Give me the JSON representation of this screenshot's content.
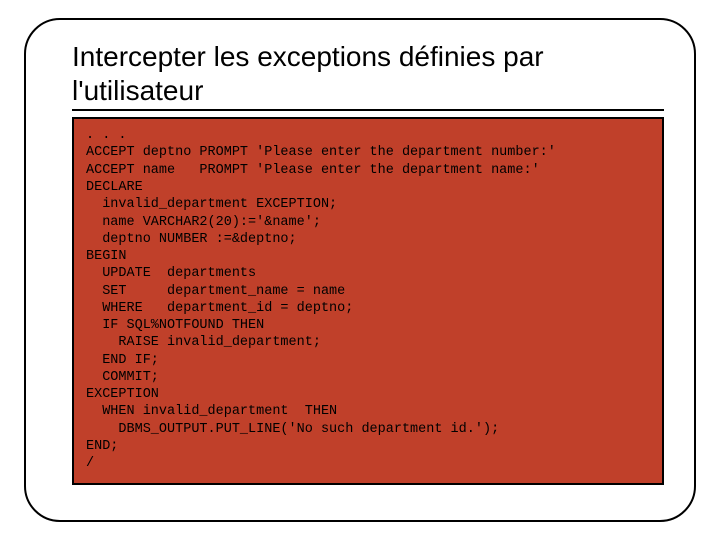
{
  "slide": {
    "title": "Intercepter les exceptions définies par l'utilisateur"
  },
  "code": {
    "l01": ". . .",
    "l02": "ACCEPT deptno PROMPT 'Please enter the department number:'",
    "l03": "ACCEPT name   PROMPT 'Please enter the department name:'",
    "l04": "DECLARE",
    "l05": "  invalid_department EXCEPTION;",
    "l06": "  name VARCHAR2(20):='&name';",
    "l07": "  deptno NUMBER :=&deptno;",
    "l08": "BEGIN",
    "l09": "  UPDATE  departments",
    "l10": "  SET     department_name = name",
    "l11": "  WHERE   department_id = deptno;",
    "l12": "  IF SQL%NOTFOUND THEN",
    "l13": "    RAISE invalid_department;",
    "l14": "  END IF;",
    "l15": "  COMMIT;",
    "l16": "EXCEPTION",
    "l17": "  WHEN invalid_department  THEN",
    "l18": "    DBMS_OUTPUT.PUT_LINE('No such department id.');",
    "l19": "END;",
    "l20": "/"
  }
}
